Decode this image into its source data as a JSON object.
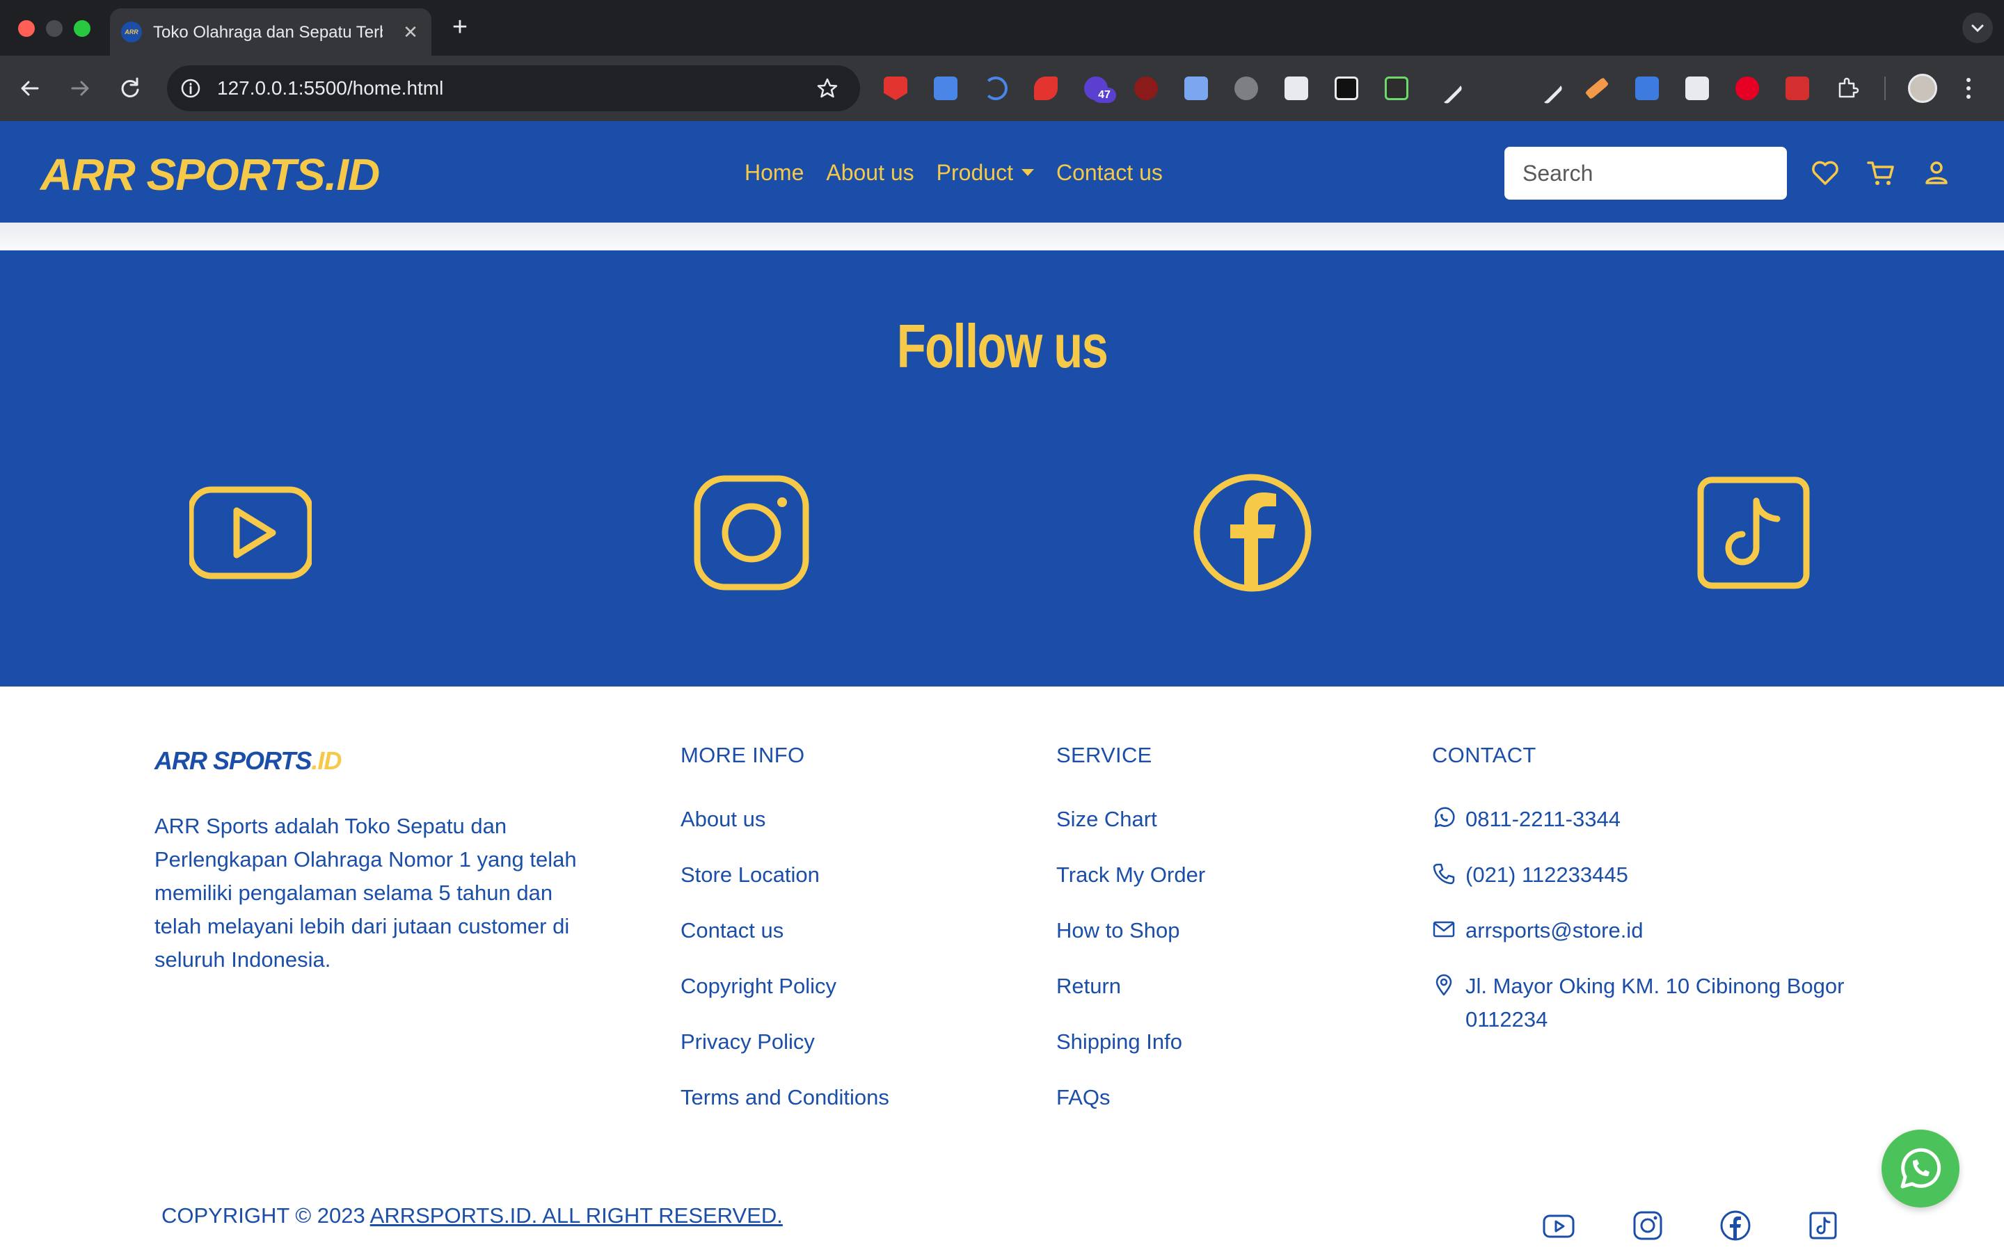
{
  "browser": {
    "tab_title": "Toko Olahraga dan Sepatu Terbaik",
    "tab_favicon_text": "ARR",
    "url": "127.0.0.1:5500/home.html",
    "extension_badge": "47"
  },
  "header": {
    "logo": "ARR SPORTS.ID",
    "nav": [
      "Home",
      "About us",
      "Product",
      "Contact us"
    ],
    "search_placeholder": "Search"
  },
  "follow": {
    "title": "Follow us",
    "icons": [
      "youtube-icon",
      "instagram-icon",
      "facebook-icon",
      "tiktok-icon"
    ]
  },
  "footer": {
    "logo_main": "ARR SPORTS",
    "logo_suffix": ".ID",
    "description": "ARR Sports adalah Toko Sepatu dan Perlengkapan Olahraga Nomor 1 yang telah memiliki pengalaman selama 5 tahun dan telah melayani lebih dari jutaan customer di seluruh Indonesia.",
    "more_info": {
      "heading": "MORE INFO",
      "links": [
        "About us",
        "Store Location",
        "Contact us",
        "Copyright Policy",
        "Privacy Policy",
        "Terms and Conditions"
      ]
    },
    "service": {
      "heading": "SERVICE",
      "links": [
        "Size Chart",
        "Track My Order",
        "How to Shop",
        "Return",
        "Shipping Info",
        "FAQs"
      ]
    },
    "contact": {
      "heading": "CONTACT",
      "whatsapp": "0811-2211-3344",
      "phone": "(021) 112233445",
      "email": "arrsports@store.id",
      "address": "Jl. Mayor Oking KM. 10 Cibinong Bogor 0112234"
    },
    "copyright_prefix": "COPYRIGHT © 2023 ",
    "copyright_link": "ARRSPORTS.ID. ALL RIGHT RESERVED."
  },
  "colors": {
    "brand_blue": "#1a4ea8",
    "brand_yellow": "#f7c948",
    "whatsapp_green": "#4cc25a"
  }
}
